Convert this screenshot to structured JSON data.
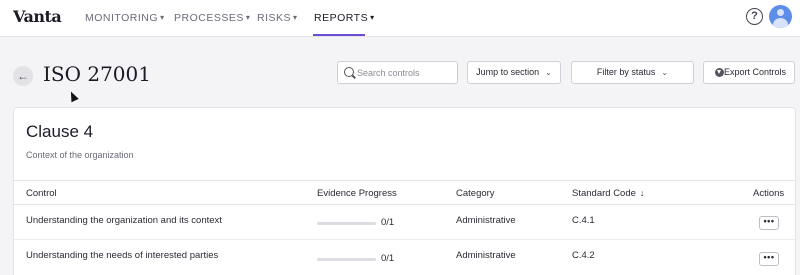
{
  "nav": {
    "logo": "Vanta",
    "items": [
      {
        "label": "MONITORING",
        "chevron": "▾"
      },
      {
        "label": "PROCESSES",
        "chevron": "▾"
      },
      {
        "label": "RISKS",
        "chevron": "▾"
      },
      {
        "label": "REPORTS",
        "chevron": "▾"
      }
    ],
    "active_item": "REPORTS",
    "help_glyph": "?",
    "accent_color": "#6d4cd6"
  },
  "header": {
    "back_glyph": "←",
    "title": "ISO 27001",
    "search_placeholder": "Search controls",
    "jump_label": "Jump to section",
    "filter_label": "Filter by status",
    "export_label": "Export Controls",
    "chevron": "⌄"
  },
  "section": {
    "title": "Clause 4",
    "subtitle": "Context of the organization",
    "columns": {
      "control": "Control",
      "progress": "Evidence Progress",
      "category": "Category",
      "code": "Standard Code",
      "sort_glyph": "↓",
      "actions": "Actions"
    },
    "rows": [
      {
        "control": "Understanding the organization and its context",
        "progress_text": "0/1",
        "progress_fraction": 0,
        "category": "Administrative",
        "code": "C.4.1",
        "actions_glyph": "•••"
      },
      {
        "control": "Understanding the needs of interested parties",
        "progress_text": "0/1",
        "progress_fraction": 0,
        "category": "Administrative",
        "code": "C.4.2",
        "actions_glyph": "•••"
      }
    ]
  }
}
